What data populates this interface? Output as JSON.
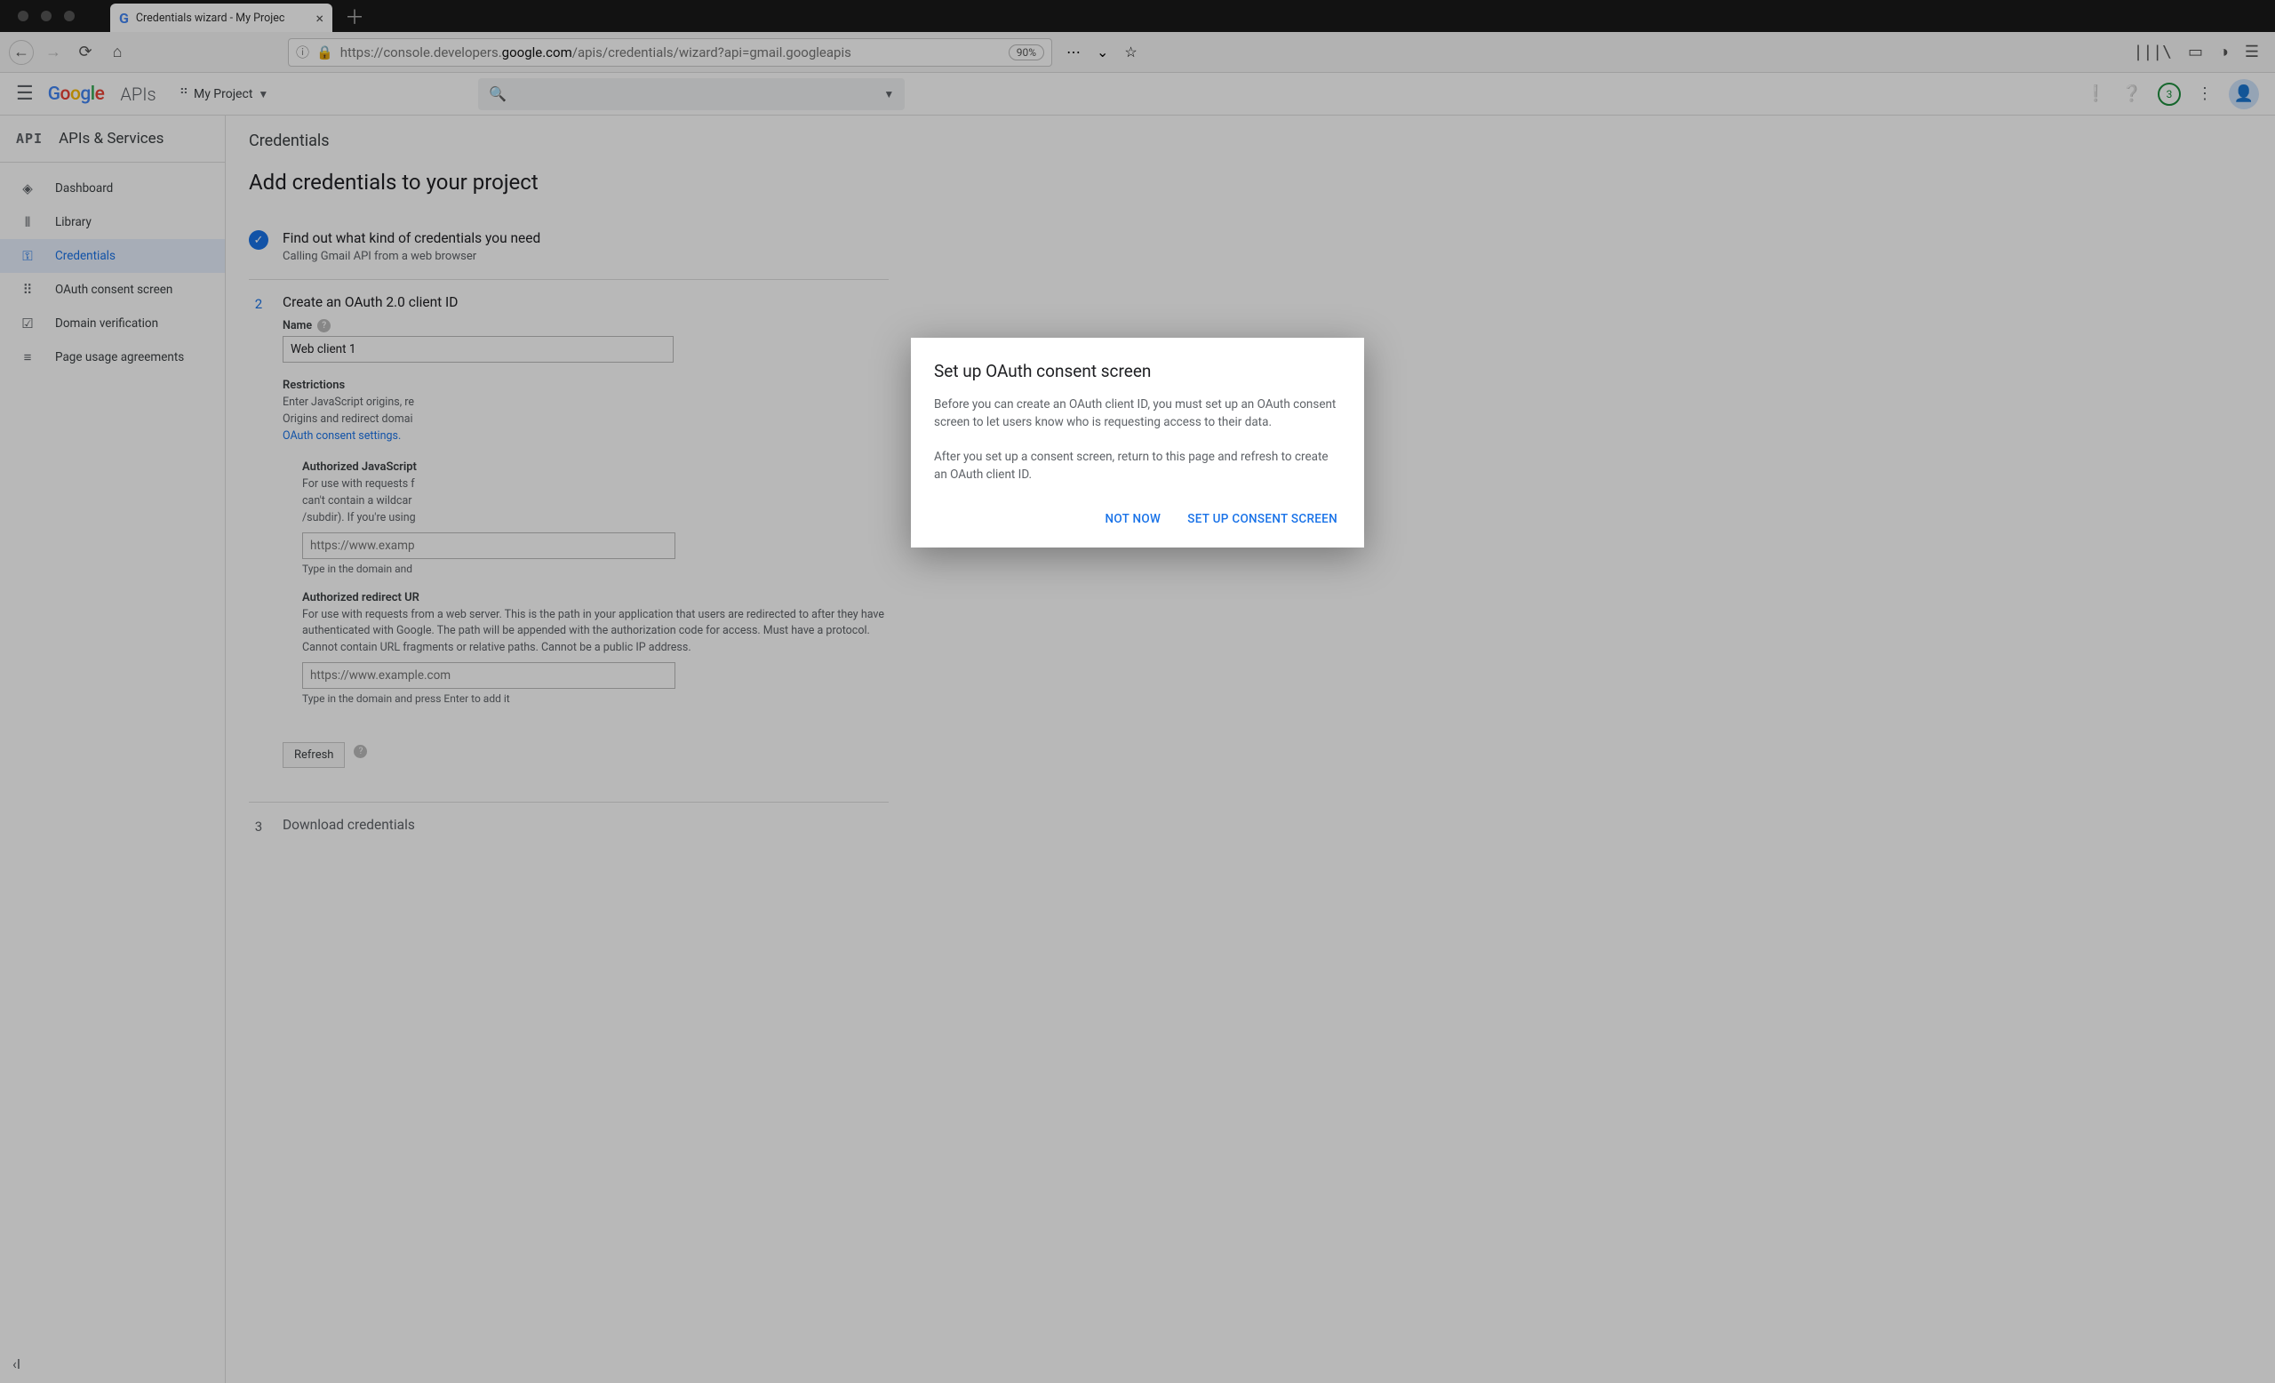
{
  "browser": {
    "tab_title": "Credentials wizard - My Projec",
    "url_prefix": "https://console.developers.",
    "url_host": "google.com",
    "url_path": "/apis/credentials/wizard?api=gmail.googleapis",
    "zoom": "90%"
  },
  "header": {
    "apis_label": "APIs",
    "project_name": "My Project",
    "badge_count": "3"
  },
  "sidebar": {
    "section_chip": "API",
    "section_title": "APIs & Services",
    "items": [
      {
        "icon": "◈",
        "label": "Dashboard"
      },
      {
        "icon": "⦀",
        "label": "Library"
      },
      {
        "icon": "⚿",
        "label": "Credentials"
      },
      {
        "icon": "⠿",
        "label": "OAuth consent screen"
      },
      {
        "icon": "☑",
        "label": "Domain verification"
      },
      {
        "icon": "≡",
        "label": "Page usage agreements"
      }
    ]
  },
  "page": {
    "title": "Credentials",
    "section_title": "Add credentials to your project"
  },
  "steps": {
    "s1_title": "Find out what kind of credentials you need",
    "s1_sub": "Calling Gmail API from a web browser",
    "s2_num": "2",
    "s2_title": "Create an OAuth 2.0 client ID",
    "name_label": "Name",
    "name_value": "Web client 1",
    "restrictions_title": "Restrictions",
    "restrictions_desc_1": "Enter JavaScript origins, re",
    "restrictions_desc_2": "Origins and redirect domai",
    "restrictions_link": "OAuth consent settings.",
    "js_title": "Authorized JavaScript ",
    "js_desc": "For use with requests f\ncan't contain a wildcar\n/subdir). If you're using",
    "js_placeholder": "https://www.examp",
    "js_hint": "Type in the domain and",
    "redir_title": "Authorized redirect UR",
    "redir_desc": "For use with requests from a web server. This is the path in your application that users are redirected to after they have authenticated with Google. The path will be appended with the authorization code for access. Must have a protocol. Cannot contain URL fragments or relative paths. Cannot be a public IP address.",
    "redir_placeholder": "https://www.example.com",
    "redir_hint": "Type in the domain and press Enter to add it",
    "refresh_label": "Refresh",
    "s3_num": "3",
    "s3_title": "Download credentials"
  },
  "modal": {
    "title": "Set up OAuth consent screen",
    "p1": "Before you can create an OAuth client ID, you must set up an OAuth consent screen to let users know who is requesting access to their data.",
    "p2": "After you set up a consent screen, return to this page and refresh to create an OAuth client ID.",
    "not_now": "NOT NOW",
    "confirm": "SET UP CONSENT SCREEN"
  }
}
